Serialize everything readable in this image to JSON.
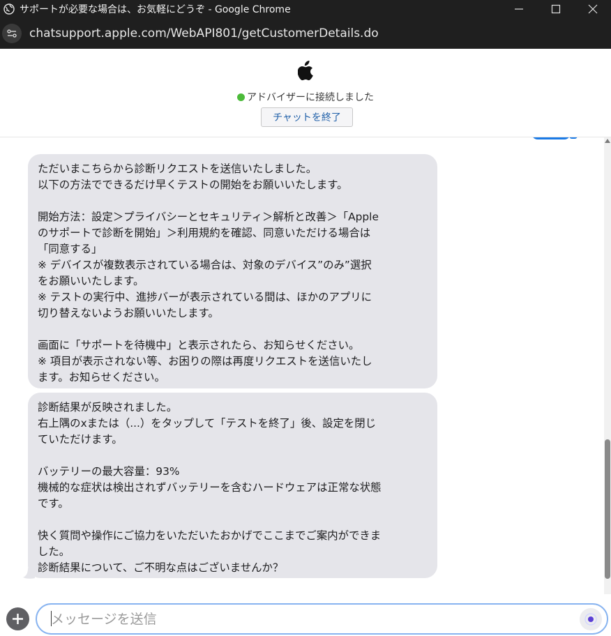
{
  "window": {
    "title": "サポートが必要な場合は、お気軽にどうぞ - Google Chrome"
  },
  "addressbar": {
    "url": "chatsupport.apple.com/WebAPI801/getCustomerDetails.do"
  },
  "header": {
    "status": "アドバイザーに接続しました",
    "status_color": "#4cbb3a",
    "end_chat_label": "チャットを終了"
  },
  "messages": [
    {
      "sender": "advisor",
      "text": "ただいまこちらから診断リクエストを送信いたしました。\n以下の方法でできるだけ早くテストの開始をお願いいたします。\n\n開始方法：設定＞プライバシーとセキュリティ＞解析と改善＞「Apple\nのサポートで診断を開始」＞利用規約を確認、同意いただける場合は\n「同意する」\n※ デバイスが複数表示されている場合は、対象のデバイス”のみ”選択\nをお願いいたします。\n※ テストの実行中、進捗バーが表示されている間は、ほかのアプリに\n切り替えないようお願いいたします。\n\n画面に「サポートを待機中」と表示されたら、お知らせください。\n※ 項目が表示されない等、お困りの際は再度リクエストを送信いたし\nます。お知らせください。"
    },
    {
      "sender": "advisor",
      "text": "診断結果が反映されました。\n右上隅のxまたは（...）をタップして「テストを終了」後、設定を閉じ\nていただけます。\n\nバッテリーの最大容量：93%\n機械的な症状は検出されずバッテリーを含むハードウェアは正常な状態\nです。\n\n快く質問や操作にご協力をいただいたおかげでここまでご案内ができま\nした。\n診断結果について、ご不明な点はございませんか？"
    }
  ],
  "composer": {
    "placeholder": "メッセージを送信",
    "value": ""
  },
  "colors": {
    "advisor_bubble": "#e5e5ea",
    "user_bubble": "#1a7ae6",
    "input_focus_border": "#87b3f0"
  }
}
